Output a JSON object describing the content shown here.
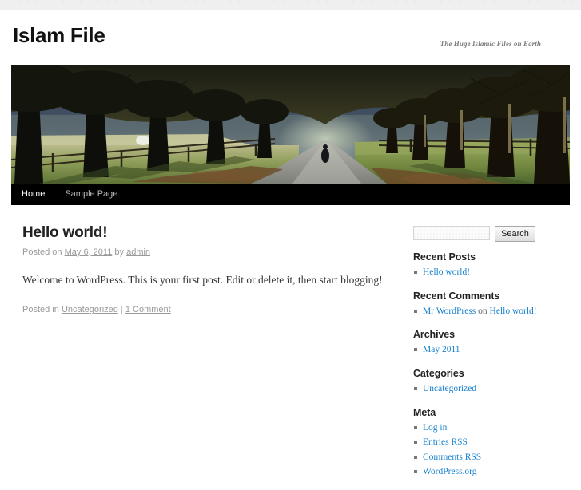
{
  "site": {
    "title": "Islam File",
    "description": "The Huge Islamic Files on Earth"
  },
  "nav": {
    "items": [
      {
        "label": "Home",
        "active": true
      },
      {
        "label": "Sample Page",
        "active": false
      }
    ]
  },
  "header_image": {
    "alt": "tree-lined path with person walking"
  },
  "post": {
    "title": "Hello world!",
    "meta_posted_on": "Posted on",
    "meta_date": "May 6, 2011",
    "meta_by": "by",
    "meta_author": "admin",
    "content": "Welcome to WordPress. This is your first post. Edit or delete it, then start blogging!",
    "footer_posted_in": "Posted in",
    "footer_category": "Uncategorized",
    "footer_separator": "|",
    "footer_comments": "1 Comment"
  },
  "search": {
    "value": "",
    "placeholder": "",
    "button_label": "Search"
  },
  "widgets": [
    {
      "title": "Recent Posts",
      "items": [
        {
          "link": "Hello world!"
        }
      ]
    },
    {
      "title": "Recent Comments",
      "items": [
        {
          "link": "Mr WordPress",
          "plain": " on ",
          "link2": "Hello world!"
        }
      ]
    },
    {
      "title": "Archives",
      "items": [
        {
          "link": "May 2011"
        }
      ]
    },
    {
      "title": "Categories",
      "items": [
        {
          "link": "Uncategorized"
        }
      ]
    },
    {
      "title": "Meta",
      "items": [
        {
          "link": "Log in"
        },
        {
          "link": "Entries RSS"
        },
        {
          "link": "Comments RSS"
        },
        {
          "link": "WordPress.org"
        }
      ]
    }
  ],
  "colors": {
    "link": "#1982d1",
    "nav_bg": "#000000",
    "text": "#373737",
    "muted": "#999999"
  }
}
